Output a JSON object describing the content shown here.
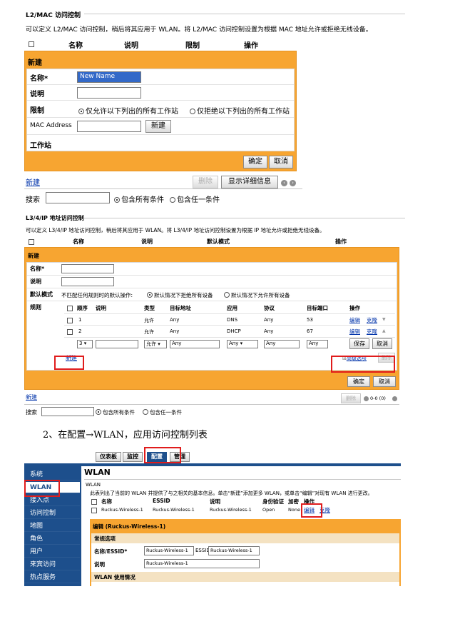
{
  "l2": {
    "title": "L2/MAC 访问控制",
    "desc": "可以定义 L2/MAC 访问控制，稍后将其应用于 WLAN。将 L2/MAC 访问控制设置为根据 MAC 地址允许或拒绝无线设备。",
    "columns": [
      "名称",
      "说明",
      "限制",
      "操作"
    ],
    "panel_title": "新建",
    "name_label": "名称*",
    "name_value": "New Name",
    "desc_label": "说明",
    "restrict_label": "限制",
    "restrict_allow": "仅允许以下列出的所有工作站",
    "restrict_deny": "仅拒绝以下列出的所有工作站",
    "mac_label": "MAC Address",
    "mac_new_button": "新建",
    "stations_label": "工作站",
    "ok_button": "确定",
    "cancel_button": "取消",
    "new_link": "新建",
    "delete_button": "删除",
    "details_button": "显示详细信息",
    "search_label": "搜索",
    "search_all": "包含所有条件",
    "search_any": "包含任一条件"
  },
  "l3": {
    "title": "L3/4/IP 地址访问控制",
    "desc": "可以定义 L3/4/IP 地址访问控制，稍后将其应用于 WLAN。将 L3/4/IP 地址访问控制设置为根据 IP 地址允许或拒绝无线设备。",
    "columns": [
      "名称",
      "说明",
      "默认模式",
      "操作"
    ],
    "panel_title": "新建",
    "name_label": "名称*",
    "desc_label": "说明",
    "mode_label": "默认模式",
    "mode_text": "不匹配任何规则时的默认操作:",
    "mode_deny": "默认情况下拒绝所有设备",
    "mode_allow": "默认情况下允许所有设备",
    "rules_label": "规则",
    "rule_columns": [
      "顺序",
      "说明",
      "类型",
      "目标地址",
      "应用",
      "协议",
      "目标端口",
      "操作"
    ],
    "rules": [
      {
        "order": "1",
        "desc": "",
        "type": "允许",
        "dest": "Any",
        "app": "DNS",
        "proto": "Any",
        "port": "53",
        "edit": "编辑",
        "clone": "克隆",
        "arrow": "▼"
      },
      {
        "order": "2",
        "desc": "",
        "type": "允许",
        "dest": "Any",
        "app": "DHCP",
        "proto": "Any",
        "port": "67",
        "edit": "编辑",
        "clone": "克隆",
        "arrow": "▲"
      }
    ],
    "edit_row": {
      "order": "3",
      "type": "允许",
      "dest": "Any",
      "app": "Any",
      "proto": "Any",
      "port": "Any",
      "save": "保存",
      "cancel": "取消"
    },
    "new_link": "新建",
    "advanced": "高级选项",
    "delete_small": "删除",
    "ok_button": "确定",
    "cancel_button": "取消",
    "new_link_bottom": "新建",
    "delete_button": "删除",
    "pager": "0-0 (0)",
    "search_label": "搜索",
    "search_all": "包含所有条件",
    "search_any": "包含任一条件"
  },
  "step_caption": "2、在配置→WLAN，应用访问控制列表",
  "wlan_ui": {
    "faint_header": "",
    "tabs": [
      "仪表板",
      "监控",
      "配置",
      "管理"
    ],
    "sidebar": [
      "系统",
      "WLAN",
      "接入点",
      "访问控制",
      "地图",
      "角色",
      "用户",
      "来宾访问",
      "热点服务"
    ],
    "page_title": "WLAN",
    "section_label": "WLAN",
    "desc": "此表列出了当前的 WLAN 并提供了与之相关的基本信息。单击“新建”添加更多 WLAN，或单击“编辑”对现有 WLAN 进行更改。",
    "columns": [
      "名称",
      "ESSID",
      "说明",
      "身份验证",
      "加密",
      "操作"
    ],
    "row": {
      "name": "Ruckus-Wireless-1",
      "essid": "Ruckus-Wireless-1",
      "desc": "Ruckus-Wireless-1",
      "auth": "Open",
      "enc": "None",
      "edit": "编辑",
      "clone": "克隆"
    },
    "edit_title": "编辑 (Ruckus-Wireless-1)",
    "general_options": "常规选项",
    "name_essid_label": "名称/ESSID*",
    "name_value": "Ruckus-Wireless-1",
    "essid_label": "ESSID",
    "essid_value": "Ruckus-Wireless-1",
    "desc_label": "说明",
    "desc_value": "Ruckus-Wireless-1",
    "usage_label": "WLAN 使用情况"
  },
  "colors": {
    "panel": "#f7a531",
    "sidebar": "#1d4f8c",
    "highlight": "#e01c1c",
    "link": "#0033aa"
  }
}
